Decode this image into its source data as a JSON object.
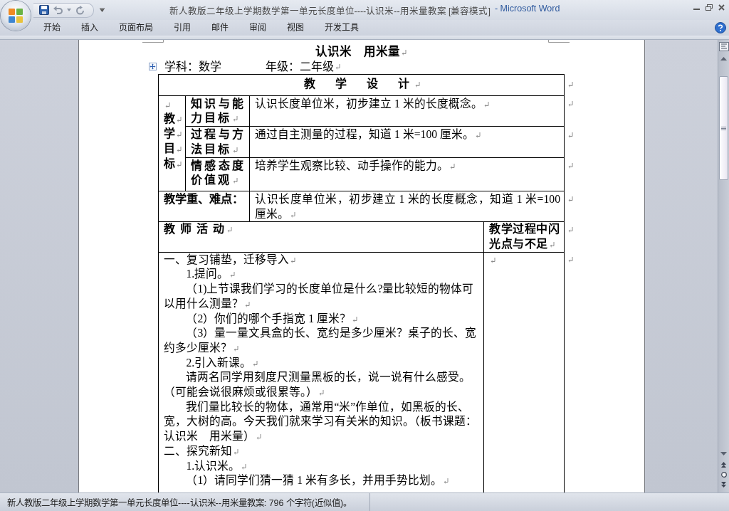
{
  "window": {
    "title": "新人教版二年级上学期数学第一单元长度单位----认识米--用米量教案 [兼容模式]",
    "app_name": "- Microsoft Word"
  },
  "ribbon_tabs": [
    {
      "label": "开始",
      "selected": false
    },
    {
      "label": "插入",
      "selected": false
    },
    {
      "label": "页面布局",
      "selected": false
    },
    {
      "label": "引用",
      "selected": false
    },
    {
      "label": "邮件",
      "selected": false
    },
    {
      "label": "审阅",
      "selected": false
    },
    {
      "label": "视图",
      "selected": false
    },
    {
      "label": "开发工具",
      "selected": false
    }
  ],
  "document": {
    "heading": {
      "text": "认识米　用米量",
      "para_mark": true
    },
    "info_line": {
      "subject": "学科：数学",
      "grade": "年级：二年级",
      "para_mark": true
    },
    "table": {
      "title": {
        "text": "教　学　设　计",
        "para_mark": true,
        "row_mark": true
      },
      "objectives": {
        "label": [
          {
            "para_mark": true
          },
          {
            "text": "教",
            "para_mark": true
          },
          {
            "text": "学",
            "para_mark": true
          },
          {
            "text": "目",
            "para_mark": true
          },
          {
            "text": "标",
            "para_mark": true
          }
        ],
        "rows": [
          {
            "label": {
              "text": "知识与能力目标",
              "para_mark": true
            },
            "content": {
              "text": "认识长度单位米，初步建立 1 米的长度概念。",
              "para_mark": true
            },
            "row_mark": true
          },
          {
            "label": {
              "text": "过程与方法目标",
              "para_mark": true
            },
            "content": {
              "text": "通过自主测量的过程，知道 1 米=100 厘米。",
              "para_mark": true
            },
            "row_mark": true
          },
          {
            "label": {
              "text": "情感态度价值观",
              "para_mark": true
            },
            "content": {
              "text": "培养学生观察比较、动手操作的能力。",
              "para_mark": true
            },
            "row_mark": true
          }
        ]
      },
      "key_points": {
        "label": {
          "text": "教学重、难点："
        },
        "content": {
          "text": "认识长度单位米，初步建立 1 米的长度概念，知道 1 米=100 厘米。",
          "para_mark": true
        },
        "row_mark": true
      },
      "activity_header": {
        "teacher": {
          "text": "教 师 活 动",
          "para_mark": true
        },
        "notes": {
          "text": "教学过程中闪光点与不足",
          "para_mark": true
        },
        "row_mark": true
      },
      "activity": {
        "paragraphs": [
          {
            "kind": "heading",
            "text": "一、复习铺垫，迁移导入",
            "para_mark": true
          },
          {
            "kind": "text",
            "text": "1.提问。",
            "para_mark": true
          },
          {
            "kind": "text",
            "text": "（1)上节课我们学习的长度单位是什么?量比较短的物体可以用什么测量？",
            "para_mark": true
          },
          {
            "kind": "text",
            "text": "（2）你们的哪个手指宽 1 厘米？",
            "para_mark": true
          },
          {
            "kind": "text",
            "text": "（3）量一量文具盒的长、宽约是多少厘米？桌子的长、宽约多少厘米？",
            "para_mark": true
          },
          {
            "kind": "text",
            "text": "2.引入新课。",
            "para_mark": true
          },
          {
            "kind": "text",
            "text": "请两名同学用刻度尺测量黑板的长，说一说有什么感受。（可能会说很麻烦或很累等。）",
            "para_mark": true
          },
          {
            "kind": "text",
            "text": "我们量比较长的物体，通常用“米”作单位，如黑板的长、宽，大树的高。今天我们就来学习有关米的知识。（板书课题：认识米　用米量）",
            "para_mark": true
          },
          {
            "kind": "heading",
            "text": "二、探究新知",
            "para_mark": true
          },
          {
            "kind": "text",
            "text": "1.认识米。",
            "para_mark": true
          },
          {
            "kind": "text",
            "text": "（1）请同学们猜一猜 1 米有多长，并用手势比划。",
            "para_mark": true
          }
        ],
        "notes": [
          {
            "para_mark": true
          }
        ],
        "row_mark": true
      }
    }
  },
  "status_bar": {
    "text": "新人教版二年级上学期数学第一单元长度单位----认识米--用米量教案: 796 个字符(近似值)。"
  }
}
